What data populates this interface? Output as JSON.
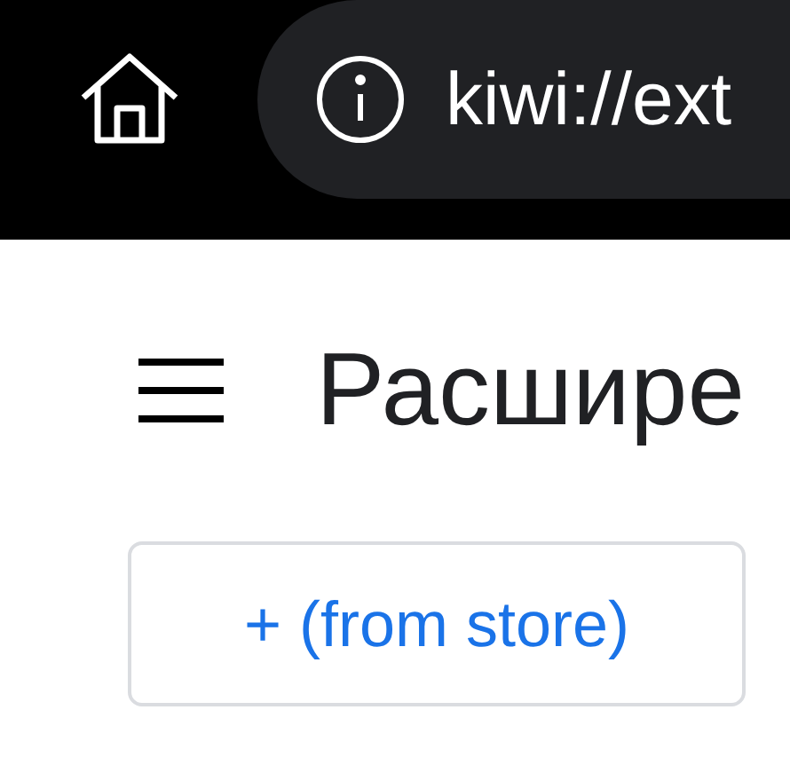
{
  "toolbar": {
    "address": "kiwi://ext"
  },
  "page": {
    "title": "Расшире",
    "add_button": "+ (from store)"
  }
}
